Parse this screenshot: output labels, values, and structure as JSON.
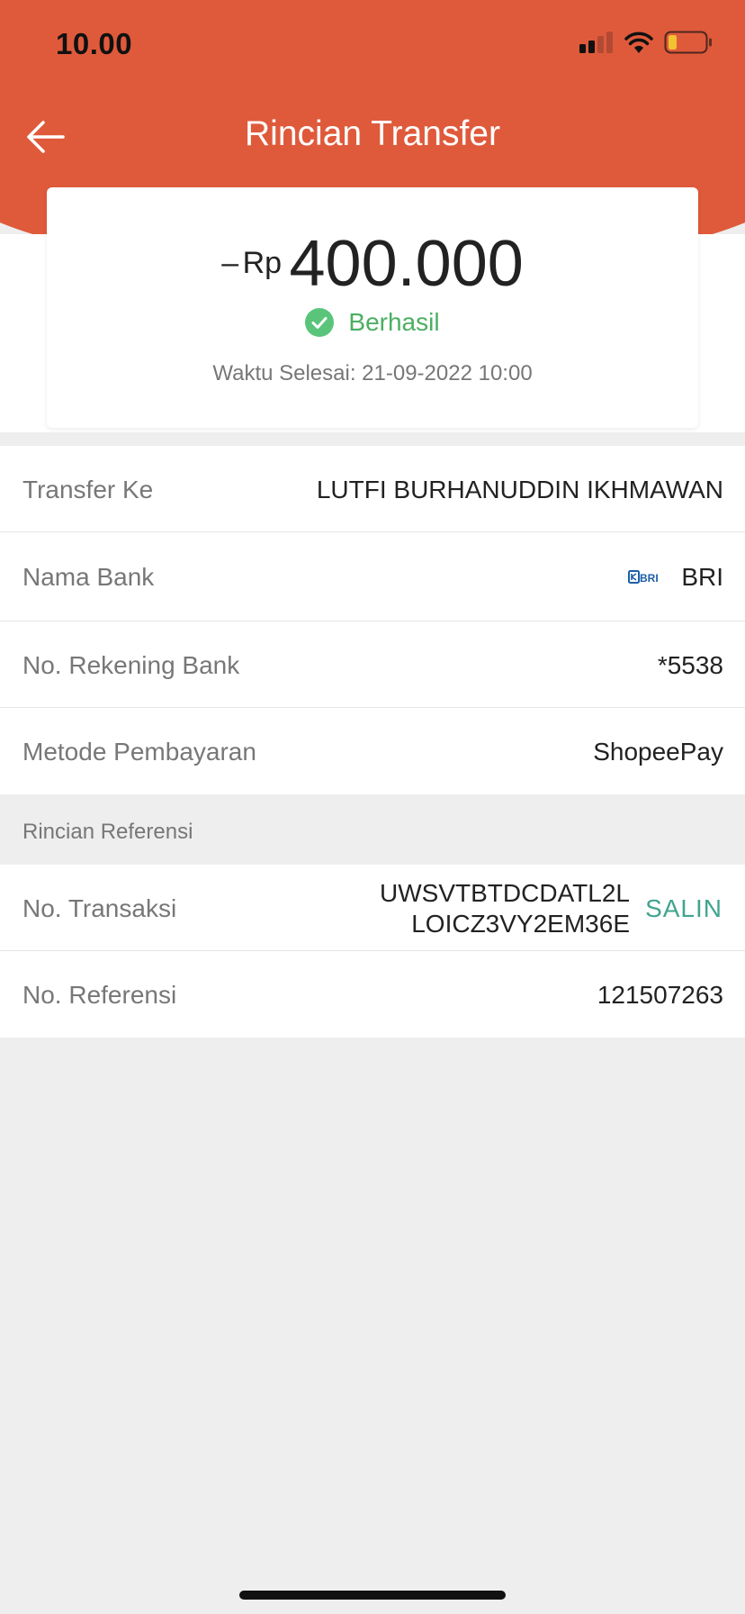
{
  "status_bar": {
    "time": "10.00"
  },
  "header": {
    "title": "Rincian Transfer",
    "back_icon": "arrow-left-icon"
  },
  "summary": {
    "sign": "–",
    "currency": "Rp",
    "amount": "400.000",
    "status": "Berhasil",
    "status_icon": "check-circle-icon",
    "completed_time": "Waktu Selesai: 21-09-2022 10:00"
  },
  "details": {
    "transfer_to": {
      "label": "Transfer Ke",
      "value": "LUTFI BURHANUDDIN IKHMAWAN"
    },
    "bank_name": {
      "label": "Nama Bank",
      "value": "BRI",
      "logo_text": "BRI"
    },
    "account_no": {
      "label": "No. Rekening Bank",
      "value": "*5538"
    },
    "payment_method": {
      "label": "Metode Pembayaran",
      "value": "ShopeePay"
    }
  },
  "reference": {
    "section_title": "Rincian Referensi",
    "transaction_no": {
      "label": "No. Transaksi",
      "value_line1": "UWSVTBTDCDATL2L",
      "value_line2": "LOICZ3VY2EM36E",
      "copy_label": "SALIN"
    },
    "reference_no": {
      "label": "No. Referensi",
      "value": "121507263"
    }
  },
  "colors": {
    "brand": "#df5a3b",
    "success": "#4caf62",
    "copy": "#41a58f",
    "background": "#eeeeee"
  }
}
